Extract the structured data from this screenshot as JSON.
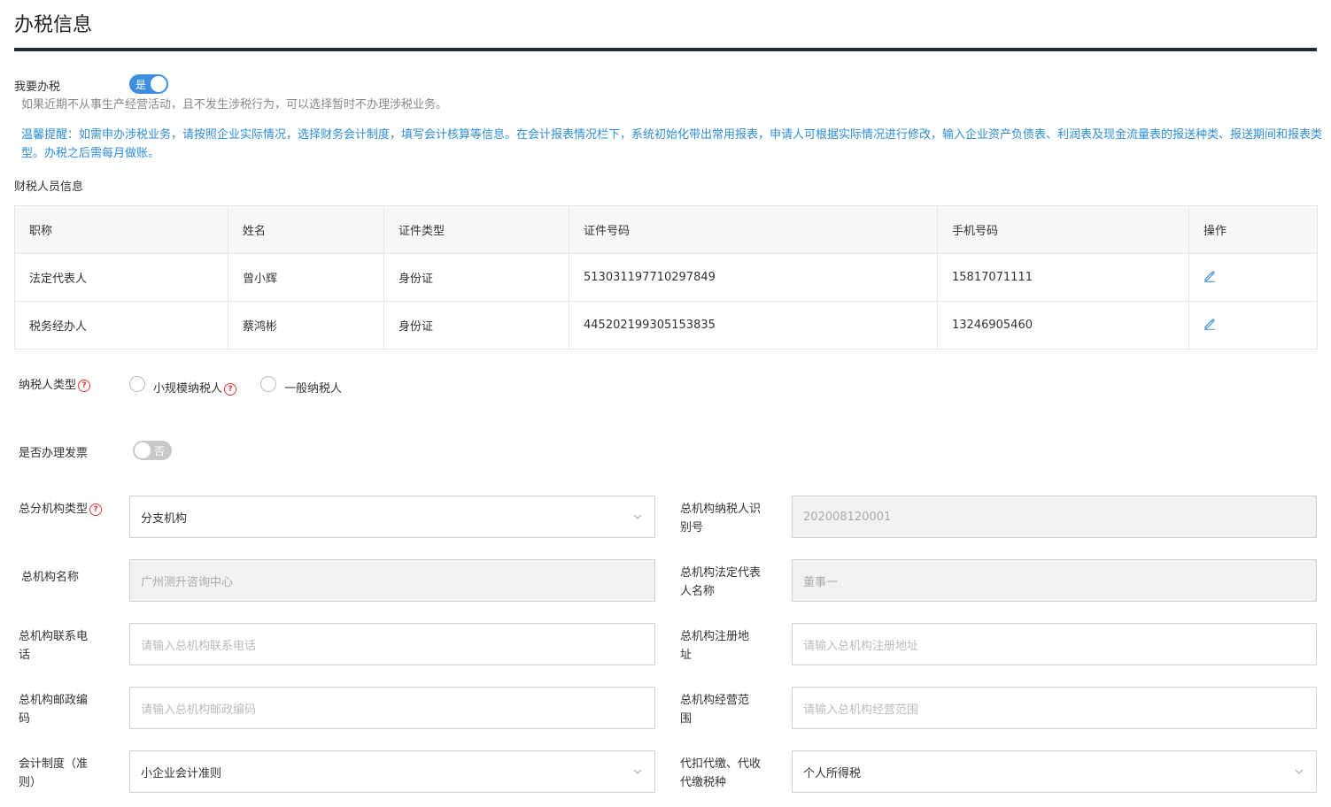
{
  "page_title": "办税信息",
  "tax_toggle": {
    "label": "我要办税",
    "state_text": "是"
  },
  "tax_hint": "如果近期不从事生产经营活动，且不发生涉税行为，可以选择暂时不办理涉税业务。",
  "notice": "温馨提醒：如需申办涉税业务，请按照企业实际情况，选择财务会计制度，填写会计核算等信息。在会计报表情况栏下，系统初始化带出常用报表，申请人可根据实际情况进行修改，输入企业资产负债表、利润表及现金流量表的报送种类、报送期间和报表类型。办税之后需每月做账。",
  "staff_section_title": "财税人员信息",
  "staff_table": {
    "headers": [
      "职称",
      "姓名",
      "证件类型",
      "证件号码",
      "手机号码",
      "操作"
    ],
    "rows": [
      [
        "法定代表人",
        "曾小辉",
        "身份证",
        "513031197710297849",
        "15817071111"
      ],
      [
        "税务经办人",
        "蔡鸿彬",
        "身份证",
        "445202199305153835",
        "13246905460"
      ]
    ]
  },
  "taxpayer_type": {
    "label": "纳税人类型",
    "options": [
      "小规模纳税人",
      "一般纳税人"
    ]
  },
  "invoice_toggle": {
    "label": "是否办理发票",
    "state_text": "否"
  },
  "form": {
    "org_type": {
      "label": "总分机构类型",
      "value": "分支机构"
    },
    "hq_taxpayer_id": {
      "label": "总机构纳税人识别号",
      "value": "202008120001"
    },
    "hq_name": {
      "label": "总机构名称",
      "value": "广州测升咨询中心"
    },
    "hq_legal_rep": {
      "label": "总机构法定代表人名称",
      "value": "董事一"
    },
    "hq_phone": {
      "label": "总机构联系电话",
      "placeholder": "请输入总机构联系电话"
    },
    "hq_address": {
      "label": "总机构注册地址",
      "placeholder": "请输入总机构注册地址"
    },
    "hq_postcode": {
      "label": "总机构邮政编码",
      "placeholder": "请输入总机构邮政编码"
    },
    "hq_scope": {
      "label": "总机构经营范围",
      "placeholder": "请输入总机构经营范围"
    },
    "accounting_system": {
      "label": "会计制度（准则）",
      "value": "小企业会计准则"
    },
    "withholding_tax": {
      "label": "代扣代缴、代收代缴税种",
      "value": "个人所得税"
    }
  },
  "colors": {
    "accent": "#3c8ee0",
    "notice": "#2d8cd6",
    "required": "#e53935",
    "rule": "#1f2a36"
  },
  "icons": {
    "edit": "pencil-icon",
    "select": "chevron-down-icon",
    "help": "question-circle-icon"
  }
}
